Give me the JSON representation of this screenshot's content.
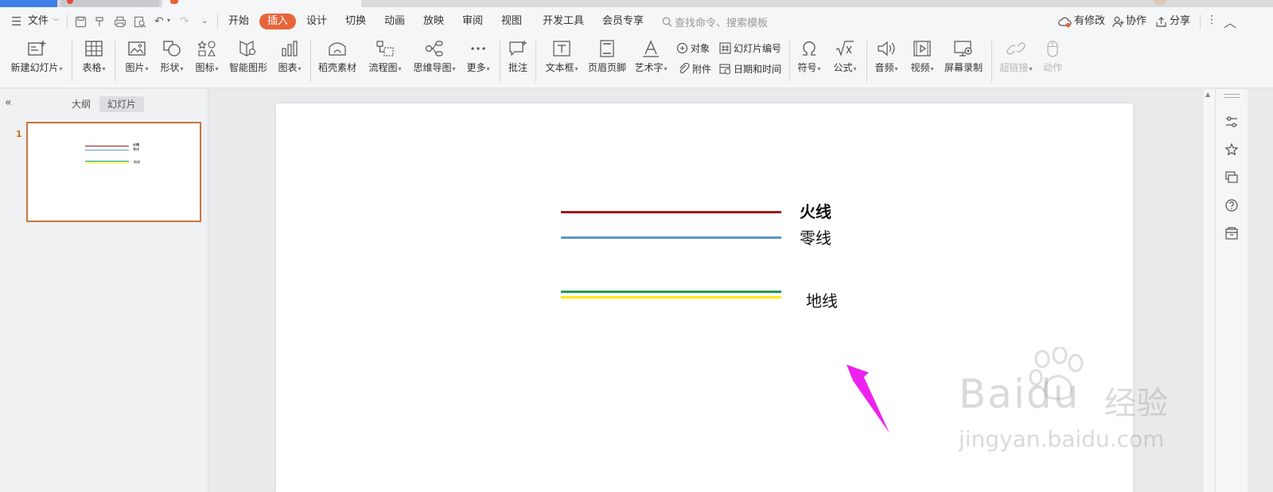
{
  "menu": {
    "file": "文件",
    "tabs": [
      "开始",
      "插入",
      "设计",
      "切换",
      "动画",
      "放映",
      "审阅",
      "视图",
      "开发工具",
      "会员专享"
    ],
    "active_tab": "插入",
    "search_placeholder": "查找命令、搜索模板",
    "right": {
      "modified": "有修改",
      "collab": "协作",
      "share": "分享"
    }
  },
  "ribbon": {
    "new_slide": "新建幻灯片",
    "table": "表格",
    "picture": "图片",
    "shape": "形状",
    "icon": "图标",
    "smartart": "智能图形",
    "chart": "图表",
    "material": "稻壳素材",
    "flowchart": "流程图",
    "mindmap": "思维导图",
    "more": "更多",
    "comment": "批注",
    "textbox": "文本框",
    "header_footer": "页眉页脚",
    "wordart": "艺术字",
    "object": "对象",
    "slide_number": "幻灯片编号",
    "attachment": "附件",
    "datetime": "日期和时间",
    "symbol": "符号",
    "formula": "公式",
    "audio": "音频",
    "video": "视频",
    "screen_record": "屏幕录制",
    "hyperlink": "超链接",
    "action": "动作"
  },
  "panel": {
    "outline_tab": "大纲",
    "slides_tab": "幻灯片",
    "slide_number": "1",
    "thumb_labels": [
      "火线",
      "零线",
      "地线"
    ]
  },
  "slide": {
    "live_label": "火线",
    "neutral_label": "零线",
    "ground_label": "地线",
    "colors": {
      "live": "#9b1c1c",
      "neutral": "#5f95c6",
      "ground_green": "#1f9a57",
      "ground_yellow": "#ffe600",
      "arrow": "#ee22ee"
    }
  },
  "watermark": {
    "brand": "Bai",
    "brand2": "du",
    "product": "经验",
    "url": "jingyan.baidu.com"
  }
}
